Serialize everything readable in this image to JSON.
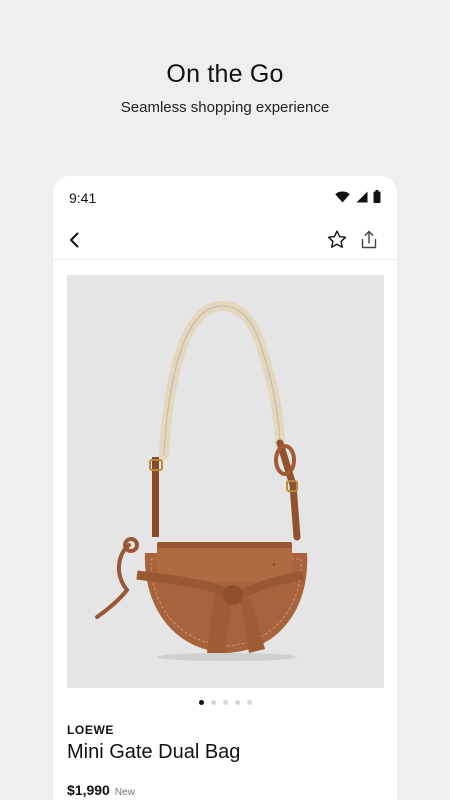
{
  "promo": {
    "title": "On the Go",
    "subtitle": "Seamless shopping experience"
  },
  "status_bar": {
    "time": "9:41",
    "icons": [
      "wifi-icon",
      "signal-icon",
      "battery-icon"
    ]
  },
  "nav": {
    "icons": [
      "back-chevron-icon",
      "star-outline-icon",
      "share-icon"
    ]
  },
  "product": {
    "brand": "LOEWE",
    "name": "Mini Gate Dual Bag",
    "price": "$1,990",
    "condition": "New",
    "image_subject": "tan leather saddle bag with knotted strap and cream shoulder strap",
    "image_count": 5,
    "active_image": 1
  },
  "colors": {
    "background": "#f0efed",
    "card": "#ffffff",
    "image_bg": "#e5e5e5",
    "leather": "#a8633d",
    "text": "#111111"
  }
}
